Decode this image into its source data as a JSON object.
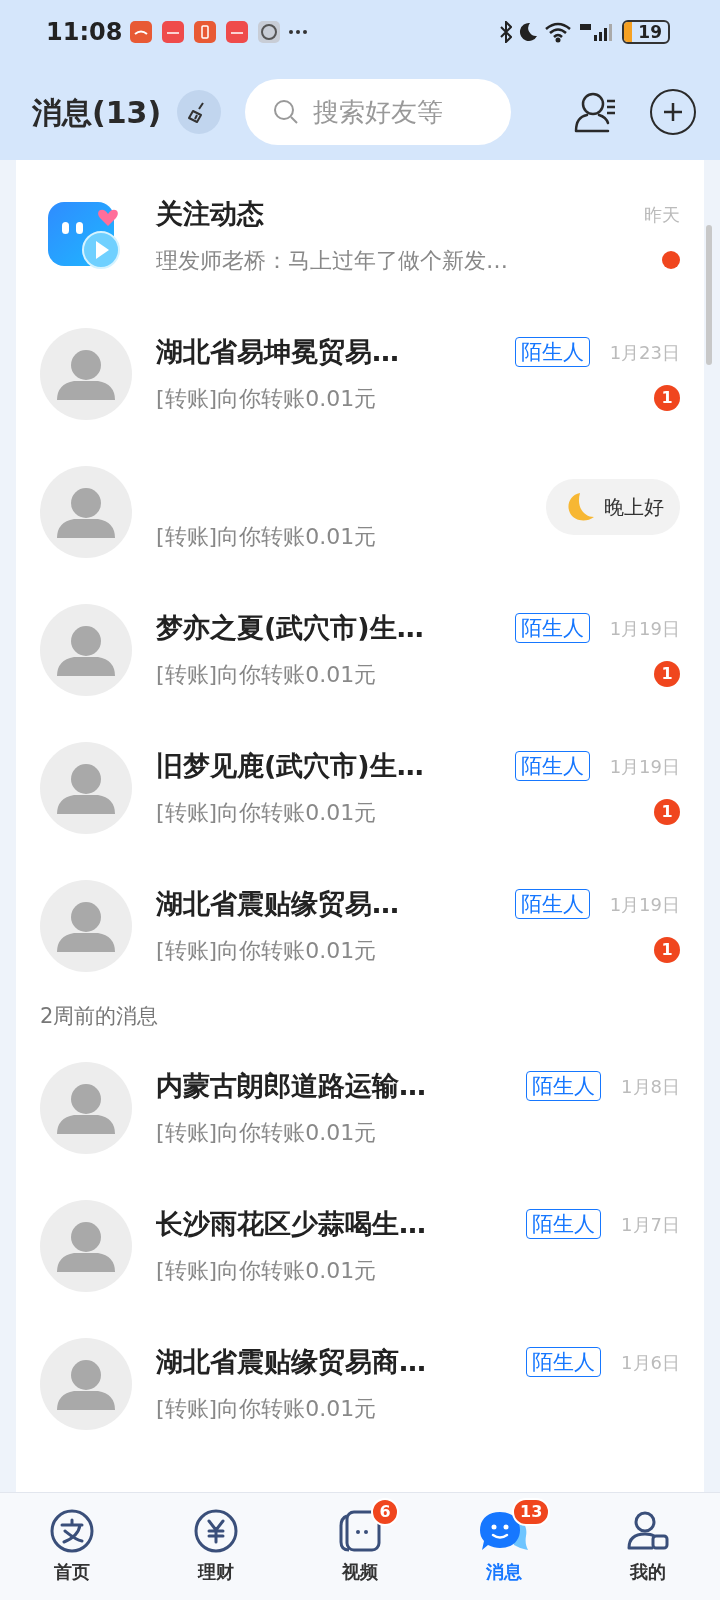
{
  "status_bar": {
    "time": "11:08",
    "battery": "19"
  },
  "header": {
    "title": "消息(13)",
    "search": {
      "placeholder": "搜索好友等"
    }
  },
  "messages": [
    {
      "kind": "follow",
      "name": "关注动态",
      "preview": "理发师老桥：马上过年了做个新发…",
      "time": "昨天",
      "dot": true
    },
    {
      "kind": "contact",
      "name": "湖北省易坤冕贸易…",
      "tag": "陌生人",
      "preview": "[转账]向你转账0.01元",
      "time": "1月23日",
      "badge": "1"
    },
    {
      "kind": "contact",
      "preview": "[转账]向你转账0.01元",
      "greeting": "晚上好"
    },
    {
      "kind": "contact",
      "name": "梦亦之夏(武穴市)生…",
      "tag": "陌生人",
      "preview": "[转账]向你转账0.01元",
      "time": "1月19日",
      "badge": "1"
    },
    {
      "kind": "contact",
      "name": "旧梦见鹿(武穴市)生…",
      "tag": "陌生人",
      "preview": "[转账]向你转账0.01元",
      "time": "1月19日",
      "badge": "1"
    },
    {
      "kind": "contact",
      "name": "湖北省震贴缘贸易…",
      "tag": "陌生人",
      "preview": "[转账]向你转账0.01元",
      "time": "1月19日",
      "badge": "1"
    },
    {
      "kind": "section",
      "label": "2周前的消息"
    },
    {
      "kind": "contact",
      "name": "内蒙古朗郎道路运输…",
      "tag": "陌生人",
      "preview": "[转账]向你转账0.01元",
      "time": "1月8日"
    },
    {
      "kind": "contact",
      "name": "长沙雨花区少蒜喝生…",
      "tag": "陌生人",
      "preview": "[转账]向你转账0.01元",
      "time": "1月7日"
    },
    {
      "kind": "contact",
      "name": "湖北省震贴缘贸易商…",
      "tag": "陌生人",
      "preview": "[转账]向你转账0.01元",
      "time": "1月6日"
    }
  ],
  "nav": [
    {
      "kind": "home",
      "label": "首页",
      "selected": false
    },
    {
      "kind": "wealth",
      "label": "理财",
      "selected": false
    },
    {
      "kind": "video",
      "label": "视频",
      "selected": false,
      "badge": "6"
    },
    {
      "kind": "messages",
      "label": "消息",
      "selected": true,
      "badge": "13"
    },
    {
      "kind": "me",
      "label": "我的",
      "selected": false
    }
  ]
}
